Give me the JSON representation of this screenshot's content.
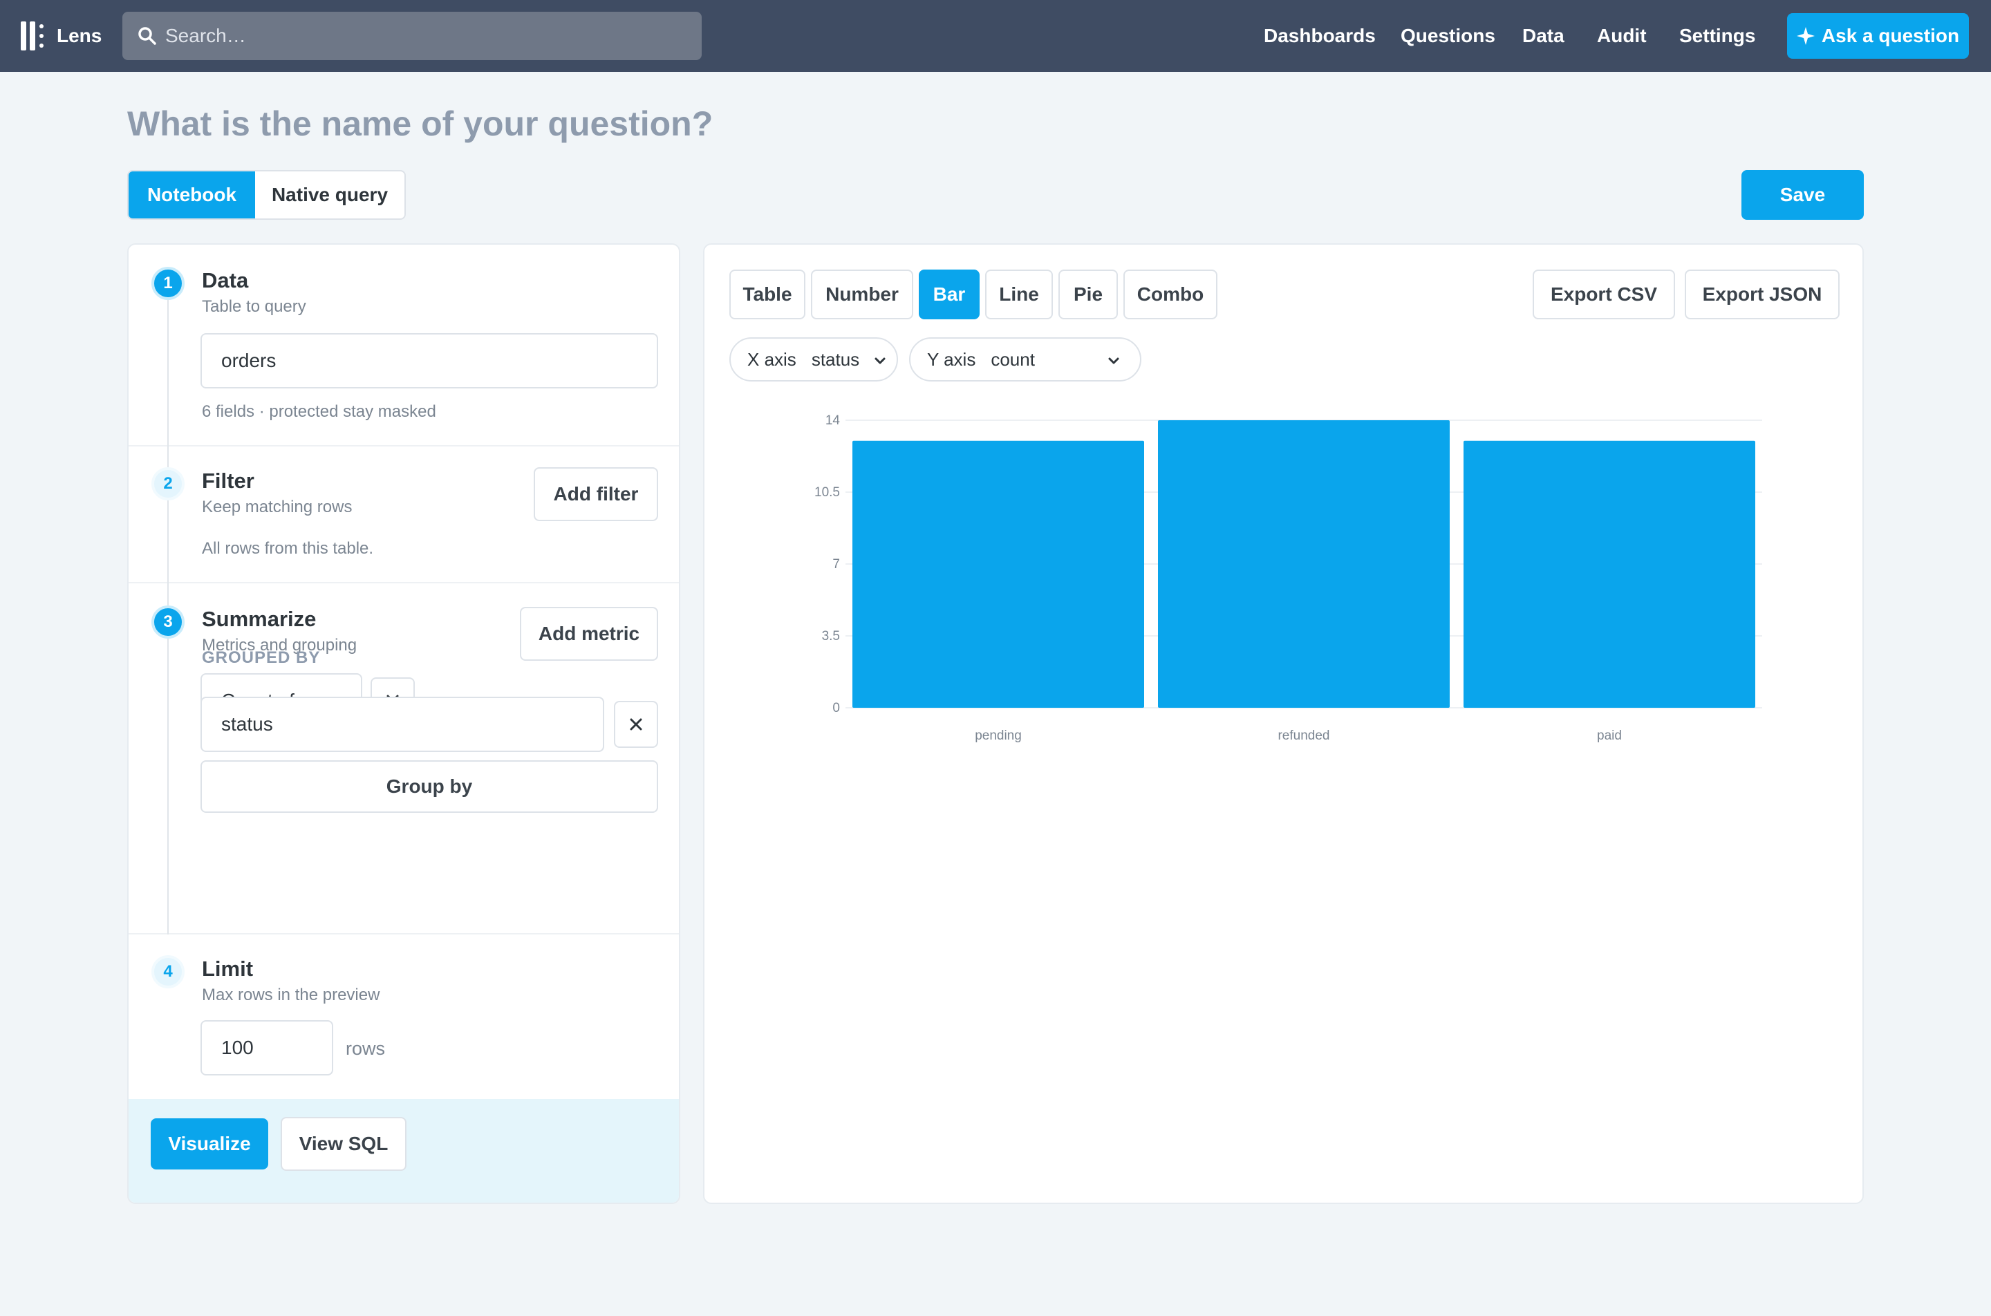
{
  "app": {
    "name": "Lens",
    "search_placeholder": "Search…",
    "nav": [
      "Dashboards",
      "Questions",
      "Data",
      "Audit",
      "Settings"
    ],
    "ask_button": "Ask a question",
    "colors": {
      "topbar": "#3f4c63",
      "accent": "#0aa5ec"
    }
  },
  "header": {
    "title": "What is the name of your question?",
    "mode_tabs": [
      "Notebook",
      "Native query"
    ],
    "active_mode": "Notebook",
    "save_label": "Save"
  },
  "notebook": {
    "steps": [
      {
        "num": "1",
        "title": "Data",
        "subtitle": "Table to query"
      },
      {
        "num": "2",
        "title": "Filter",
        "subtitle": "Keep matching rows"
      },
      {
        "num": "3",
        "title": "Summarize",
        "subtitle": "Metrics and grouping"
      },
      {
        "num": "4",
        "title": "Limit",
        "subtitle": "Max rows in the preview"
      }
    ],
    "data": {
      "table_value": "orders",
      "fields_note": "6 fields · protected stay masked"
    },
    "filter": {
      "add_label": "Add filter",
      "empty_note": "All rows from this table."
    },
    "summarize": {
      "add_label": "Add metric",
      "metric": "Count of rows",
      "grouped_by_label": "GROUPED BY",
      "group_field": "status",
      "group_by_button": "Group by"
    },
    "limit": {
      "value": "100",
      "unit": "rows"
    },
    "footer": {
      "visualize_label": "Visualize",
      "view_sql_label": "View SQL"
    }
  },
  "viz": {
    "chart_types": [
      "Table",
      "Number",
      "Bar",
      "Line",
      "Pie",
      "Combo"
    ],
    "active_type": "Bar",
    "export_csv": "Export CSV",
    "export_json": "Export JSON",
    "x_axis": {
      "label": "X axis",
      "value": "status"
    },
    "y_axis": {
      "label": "Y axis",
      "value": "count"
    }
  },
  "chart_data": {
    "type": "bar",
    "categories": [
      "pending",
      "refunded",
      "paid"
    ],
    "values": [
      13,
      14,
      13
    ],
    "ylim": [
      0,
      14
    ],
    "yticks": [
      0,
      3.5,
      7,
      10.5,
      14
    ],
    "bar_color": "#0aa5ec",
    "grid": true
  }
}
